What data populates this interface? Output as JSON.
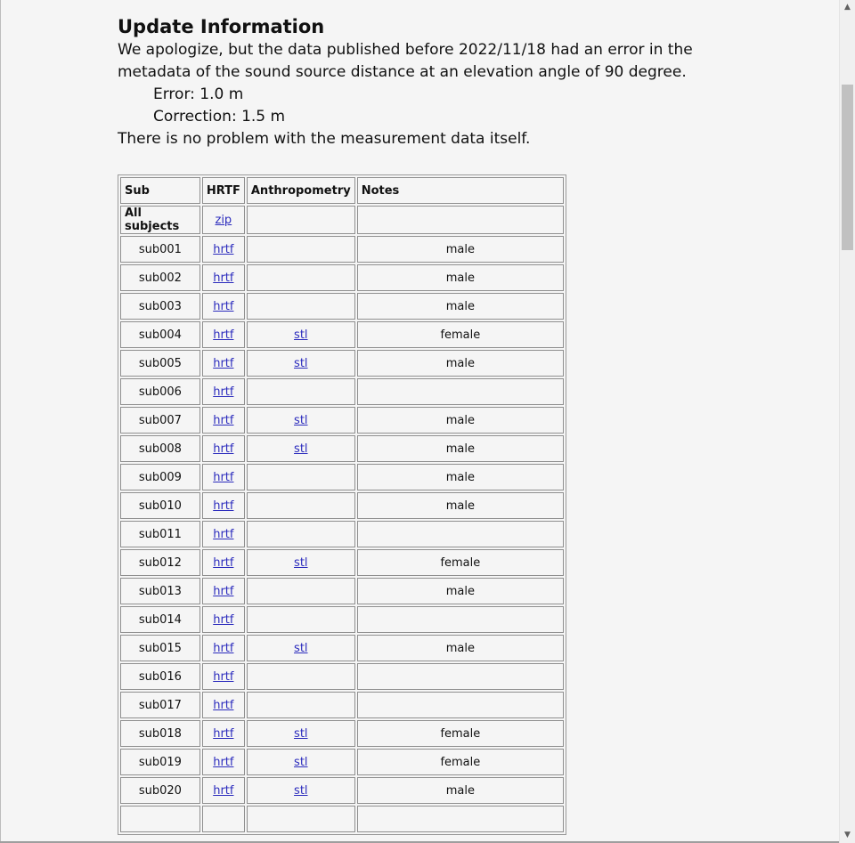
{
  "update": {
    "title": "Update Information",
    "line1": "We apologize, but the data published before 2022/11/18 had an error in the",
    "line2": "metadata of the sound source distance at an elevation angle of 90 degree.",
    "error": "Error: 1.0 m",
    "correction": "Correction: 1.5 m",
    "line3": "There is no problem with the measurement data itself."
  },
  "table": {
    "headers": [
      "Sub",
      "HRTF",
      "Anthropometry",
      "Notes"
    ],
    "all_row": {
      "label": "All subjects",
      "link": "zip"
    },
    "rows": [
      {
        "sub": "sub001",
        "hrtf": "hrtf",
        "anthro": "",
        "notes": "male"
      },
      {
        "sub": "sub002",
        "hrtf": "hrtf",
        "anthro": "",
        "notes": "male"
      },
      {
        "sub": "sub003",
        "hrtf": "hrtf",
        "anthro": "",
        "notes": "male"
      },
      {
        "sub": "sub004",
        "hrtf": "hrtf",
        "anthro": "stl",
        "notes": "female"
      },
      {
        "sub": "sub005",
        "hrtf": "hrtf",
        "anthro": "stl",
        "notes": "male"
      },
      {
        "sub": "sub006",
        "hrtf": "hrtf",
        "anthro": "",
        "notes": ""
      },
      {
        "sub": "sub007",
        "hrtf": "hrtf",
        "anthro": "stl",
        "notes": "male"
      },
      {
        "sub": "sub008",
        "hrtf": "hrtf",
        "anthro": "stl",
        "notes": "male"
      },
      {
        "sub": "sub009",
        "hrtf": "hrtf",
        "anthro": "",
        "notes": "male"
      },
      {
        "sub": "sub010",
        "hrtf": "hrtf",
        "anthro": "",
        "notes": "male"
      },
      {
        "sub": "sub011",
        "hrtf": "hrtf",
        "anthro": "",
        "notes": ""
      },
      {
        "sub": "sub012",
        "hrtf": "hrtf",
        "anthro": "stl",
        "notes": "female"
      },
      {
        "sub": "sub013",
        "hrtf": "hrtf",
        "anthro": "",
        "notes": "male"
      },
      {
        "sub": "sub014",
        "hrtf": "hrtf",
        "anthro": "",
        "notes": ""
      },
      {
        "sub": "sub015",
        "hrtf": "hrtf",
        "anthro": "stl",
        "notes": "male"
      },
      {
        "sub": "sub016",
        "hrtf": "hrtf",
        "anthro": "",
        "notes": ""
      },
      {
        "sub": "sub017",
        "hrtf": "hrtf",
        "anthro": "",
        "notes": ""
      },
      {
        "sub": "sub018",
        "hrtf": "hrtf",
        "anthro": "stl",
        "notes": "female"
      },
      {
        "sub": "sub019",
        "hrtf": "hrtf",
        "anthro": "stl",
        "notes": "female"
      },
      {
        "sub": "sub020",
        "hrtf": "hrtf",
        "anthro": "stl",
        "notes": "male"
      },
      {
        "sub": "",
        "hrtf": "",
        "anthro": "",
        "notes": ""
      }
    ]
  },
  "scrollbar": {
    "up_icon": "scroll-up-arrow-icon",
    "down_icon": "scroll-down-arrow-icon"
  }
}
